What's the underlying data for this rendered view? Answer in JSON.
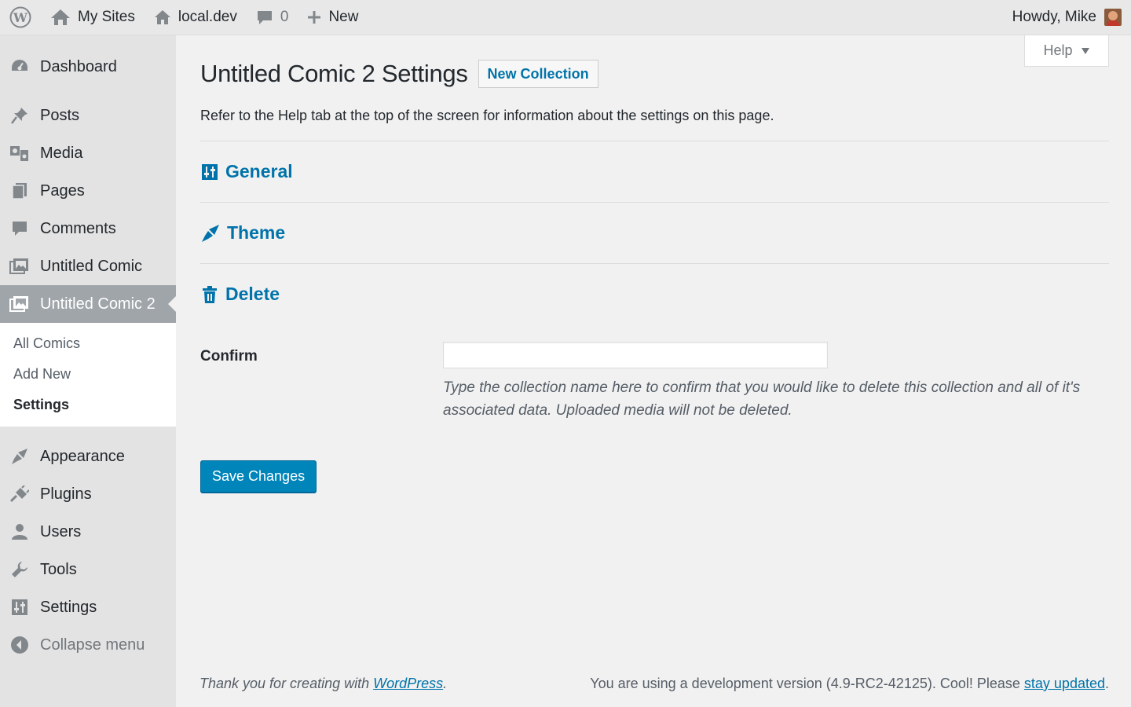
{
  "adminbar": {
    "my_sites": "My Sites",
    "site": "local.dev",
    "comments_count": "0",
    "new_label": "New",
    "howdy": "Howdy, Mike"
  },
  "sidebar": {
    "items": [
      {
        "label": "Dashboard",
        "icon": "dashboard-icon"
      },
      {
        "label": "Posts",
        "icon": "pushpin-icon"
      },
      {
        "label": "Media",
        "icon": "media-icon"
      },
      {
        "label": "Pages",
        "icon": "pages-icon"
      },
      {
        "label": "Comments",
        "icon": "comment-icon"
      },
      {
        "label": "Untitled Comic",
        "icon": "comic-icon"
      },
      {
        "label": "Untitled Comic 2",
        "icon": "comic-icon"
      },
      {
        "label": "Appearance",
        "icon": "paintbrush-icon"
      },
      {
        "label": "Plugins",
        "icon": "plug-icon"
      },
      {
        "label": "Users",
        "icon": "user-icon"
      },
      {
        "label": "Tools",
        "icon": "wrench-icon"
      },
      {
        "label": "Settings",
        "icon": "sliders-icon"
      }
    ],
    "submenu": [
      "All Comics",
      "Add New",
      "Settings"
    ],
    "collapse": "Collapse menu"
  },
  "help_tab": "Help",
  "main": {
    "title": "Untitled Comic 2 Settings",
    "new_collection": "New Collection",
    "intro": "Refer to the Help tab at the top of the screen for information about the settings on this page.",
    "sections": [
      "General",
      "Theme",
      "Delete"
    ],
    "confirm_label": "Confirm",
    "confirm_value": "",
    "confirm_desc": "Type the collection name here to confirm that you would like to delete this collection and all of it's associated data. Uploaded media will not be deleted.",
    "save": "Save Changes"
  },
  "footer": {
    "left_prefix": "Thank you for creating with ",
    "left_link": "WordPress",
    "left_suffix": ".",
    "right_prefix": "You are using a development version (4.9-RC2-42125). Cool! Please ",
    "right_link": "stay updated",
    "right_suffix": "."
  },
  "colors": {
    "accent": "#0073aa",
    "button": "#0085ba",
    "sidebar_current": "#a0a5aa"
  }
}
